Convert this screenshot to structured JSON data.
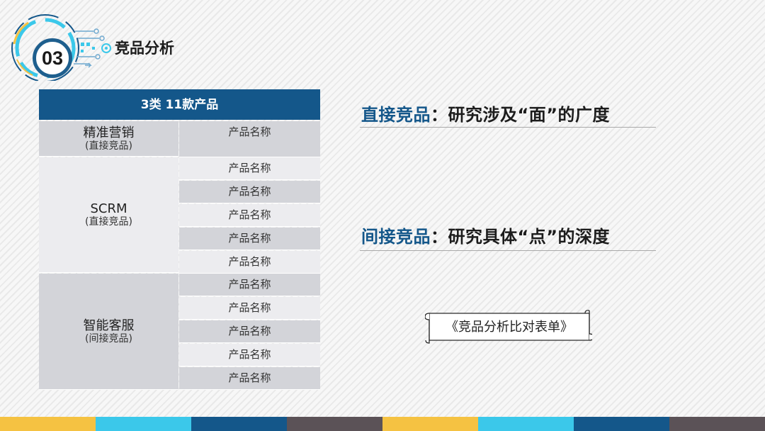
{
  "header": {
    "number": "03",
    "title": "竞品分析"
  },
  "table": {
    "header": "3类  11款产品",
    "categories": [
      {
        "name": "精准营销",
        "sub": "(直接竞品)"
      },
      {
        "name": "SCRM",
        "sub": "(直接竞品)"
      },
      {
        "name": "智能客服",
        "sub": "(间接竞品)"
      }
    ],
    "products": [
      "产品名称",
      "产品名称",
      "产品名称",
      "产品名称",
      "产品名称",
      "产品名称",
      "产品名称",
      "产品名称",
      "产品名称",
      "产品名称",
      "产品名称"
    ]
  },
  "right": {
    "heading1_prefix": "直接竞品",
    "heading1_rest": "：研究涉及“面”的广度",
    "heading2_prefix": "间接竞品",
    "heading2_rest": "：研究具体“点”的深度",
    "scroll_label": "《竞品分析比对表单》"
  },
  "colors": {
    "accent": "#14578a",
    "bottom_bar": [
      "#f5c242",
      "#3bc8ea",
      "#14578a",
      "#5b5257",
      "#f5c242",
      "#3bc8ea",
      "#14578a",
      "#5b5257"
    ]
  }
}
